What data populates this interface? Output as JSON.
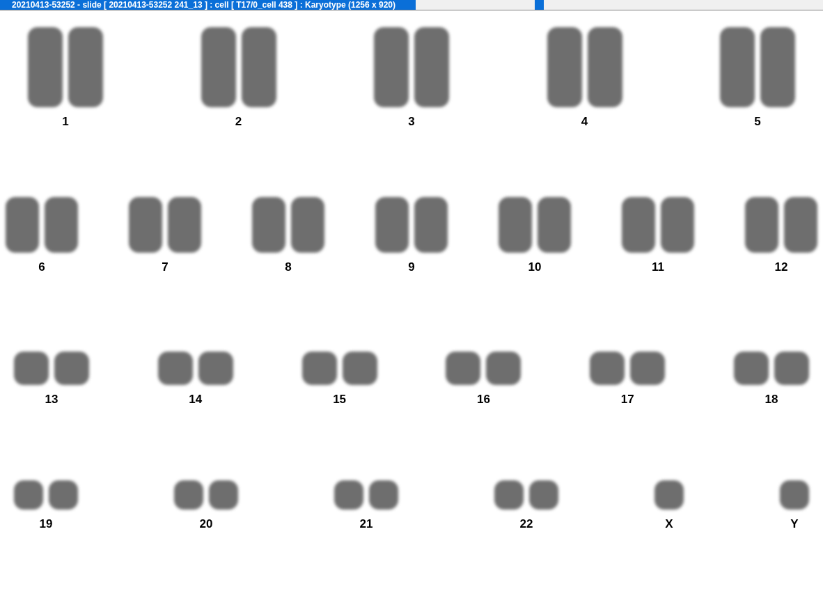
{
  "window": {
    "title": "20210413-53252 - slide [ 20210413-53252 241_13 ] : cell [ T17/0_cell 438 ] : Karyotype  (1256 x 920)"
  },
  "karyotype": {
    "rows": [
      [
        {
          "label": "1",
          "kind": "pair"
        },
        {
          "label": "2",
          "kind": "pair"
        },
        {
          "label": "3",
          "kind": "pair"
        },
        {
          "label": "4",
          "kind": "pair"
        },
        {
          "label": "5",
          "kind": "pair"
        }
      ],
      [
        {
          "label": "6",
          "kind": "pair"
        },
        {
          "label": "7",
          "kind": "pair"
        },
        {
          "label": "8",
          "kind": "pair"
        },
        {
          "label": "9",
          "kind": "pair"
        },
        {
          "label": "10",
          "kind": "pair"
        },
        {
          "label": "11",
          "kind": "pair"
        },
        {
          "label": "12",
          "kind": "pair"
        }
      ],
      [
        {
          "label": "13",
          "kind": "pair"
        },
        {
          "label": "14",
          "kind": "pair"
        },
        {
          "label": "15",
          "kind": "pair"
        },
        {
          "label": "16",
          "kind": "pair"
        },
        {
          "label": "17",
          "kind": "pair"
        },
        {
          "label": "18",
          "kind": "pair"
        }
      ],
      [
        {
          "label": "19",
          "kind": "pair"
        },
        {
          "label": "20",
          "kind": "pair"
        },
        {
          "label": "21",
          "kind": "pair"
        },
        {
          "label": "22",
          "kind": "pair"
        },
        {
          "label": "X",
          "kind": "single"
        },
        {
          "label": "Y",
          "kind": "single"
        }
      ]
    ]
  }
}
